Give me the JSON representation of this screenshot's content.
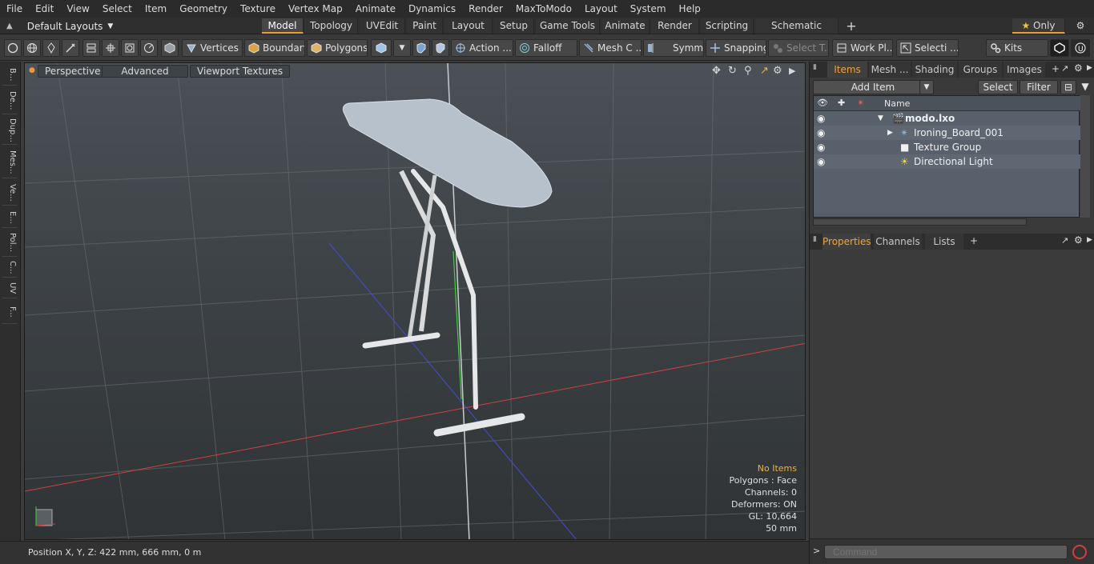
{
  "menu": [
    "File",
    "Edit",
    "View",
    "Select",
    "Item",
    "Geometry",
    "Texture",
    "Vertex Map",
    "Animate",
    "Dynamics",
    "Render",
    "MaxToModo",
    "Layout",
    "System",
    "Help"
  ],
  "layouts_label": "Default Layouts",
  "tabs": [
    "Model",
    "Topology",
    "UVEdit",
    "Paint",
    "Layout",
    "Setup",
    "Game Tools",
    "Animate",
    "Render",
    "Scripting",
    "Schematic Fusion"
  ],
  "add_tab": "+",
  "only_label": "Only",
  "toolbar": {
    "vertices": "Vertices",
    "boundary": "Boundary",
    "polygons": "Polygons",
    "action": "Action ...",
    "falloff": "Falloff",
    "mesh": "Mesh C ...",
    "symm": "Symm ...",
    "snapping": "Snapping",
    "select_t": "Select T...",
    "work_pl": "Work Pl...",
    "selecti": "Selecti ...",
    "kits": "Kits"
  },
  "left_tabs": [
    "B...",
    "De...",
    "Dup...",
    "Mes...",
    "Ve...",
    "E...",
    "Pol...",
    "C...",
    "UV",
    "F..."
  ],
  "viewport": {
    "buttons": [
      "Perspective",
      "Advanced",
      "Viewport Textures"
    ],
    "info": {
      "status": "No Items",
      "polygons": "Polygons : Face",
      "channels": "Channels: 0",
      "deformers": "Deformers: ON",
      "gl": "GL: 10,664",
      "scale": "50 mm"
    }
  },
  "status_bar": "Position X, Y, Z:   422 mm, 666 mm, 0 m",
  "items_panel": {
    "tabs": [
      "Items",
      "Mesh ...",
      "Shading",
      "Groups",
      "Images"
    ],
    "add_item": "Add Item",
    "select": "Select",
    "filter": "Filter",
    "col_name": "Name",
    "rows": [
      "modo.lxo",
      "Ironing_Board_001",
      "Texture Group",
      "Directional Light"
    ]
  },
  "properties_panel": {
    "tabs": [
      "Properties",
      "Channels",
      "Lists"
    ]
  },
  "command_placeholder": "Command",
  "colors": {
    "accent": "#f0a338",
    "x_axis": "#d04040",
    "y_axis": "#40d040",
    "z_axis": "#4050d0"
  }
}
